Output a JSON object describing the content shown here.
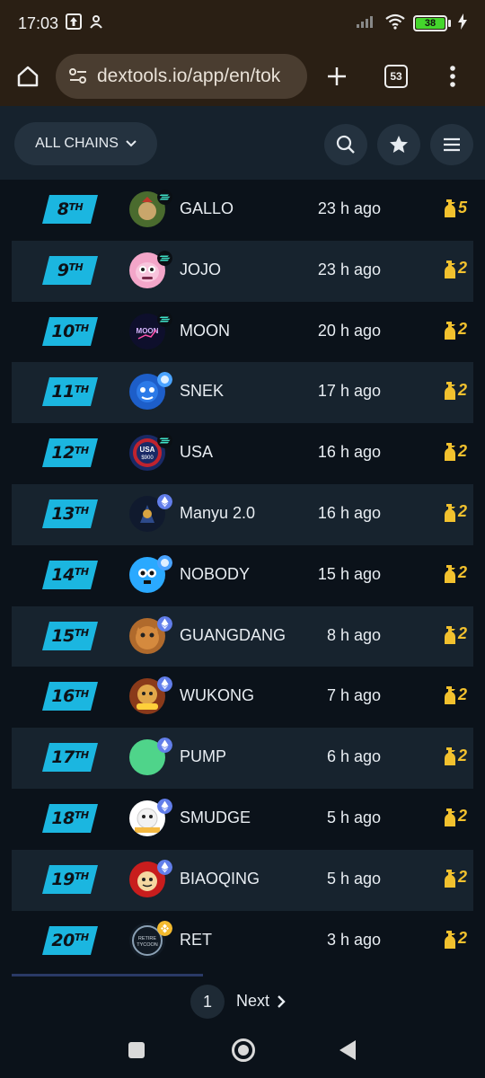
{
  "status_bar": {
    "time": "17:03",
    "battery": "38"
  },
  "browser": {
    "url": "dextools.io/app/en/tok",
    "tab_count": "53"
  },
  "header": {
    "chains_label": "ALL CHAINS"
  },
  "rows": [
    {
      "rank": "8",
      "suffix": "TH",
      "name": "GALLO",
      "ago": "23 h ago",
      "hot": "5",
      "chain": "sol",
      "avatar": "gallo"
    },
    {
      "rank": "9",
      "suffix": "TH",
      "name": "JOJO",
      "ago": "23 h ago",
      "hot": "2",
      "chain": "sol",
      "avatar": "jojo"
    },
    {
      "rank": "10",
      "suffix": "TH",
      "name": "MOON",
      "ago": "20 h ago",
      "hot": "2",
      "chain": "sol",
      "avatar": "moon"
    },
    {
      "rank": "11",
      "suffix": "TH",
      "name": "SNEK",
      "ago": "17 h ago",
      "hot": "2",
      "chain": "ton",
      "avatar": "snek"
    },
    {
      "rank": "12",
      "suffix": "TH",
      "name": "USA",
      "ago": "16 h ago",
      "hot": "2",
      "chain": "sol",
      "avatar": "usa"
    },
    {
      "rank": "13",
      "suffix": "TH",
      "name": "Manyu 2.0",
      "ago": "16 h ago",
      "hot": "2",
      "chain": "eth",
      "avatar": "manyu"
    },
    {
      "rank": "14",
      "suffix": "TH",
      "name": "NOBODY",
      "ago": "15 h ago",
      "hot": "2",
      "chain": "ton",
      "avatar": "nobody"
    },
    {
      "rank": "15",
      "suffix": "TH",
      "name": "GUANGDANG",
      "ago": "8 h ago",
      "hot": "2",
      "chain": "eth",
      "avatar": "guangdang"
    },
    {
      "rank": "16",
      "suffix": "TH",
      "name": "WUKONG",
      "ago": "7 h ago",
      "hot": "2",
      "chain": "eth",
      "avatar": "wukong"
    },
    {
      "rank": "17",
      "suffix": "TH",
      "name": "PUMP",
      "ago": "6 h ago",
      "hot": "2",
      "chain": "eth",
      "avatar": "pump"
    },
    {
      "rank": "18",
      "suffix": "TH",
      "name": "SMUDGE",
      "ago": "5 h ago",
      "hot": "2",
      "chain": "eth",
      "avatar": "smudge"
    },
    {
      "rank": "19",
      "suffix": "TH",
      "name": "BIAOQING",
      "ago": "5 h ago",
      "hot": "2",
      "chain": "eth",
      "avatar": "biaoqing"
    },
    {
      "rank": "20",
      "suffix": "TH",
      "name": "RET",
      "ago": "3 h ago",
      "hot": "2",
      "chain": "bsc",
      "avatar": "ret"
    }
  ],
  "pagination": {
    "current": "1",
    "next_label": "Next"
  },
  "colors": {
    "rank_badge": "#1bb6e0",
    "hot": "#f2c12e",
    "row_alt": "#17232e",
    "background": "#0b121a"
  }
}
